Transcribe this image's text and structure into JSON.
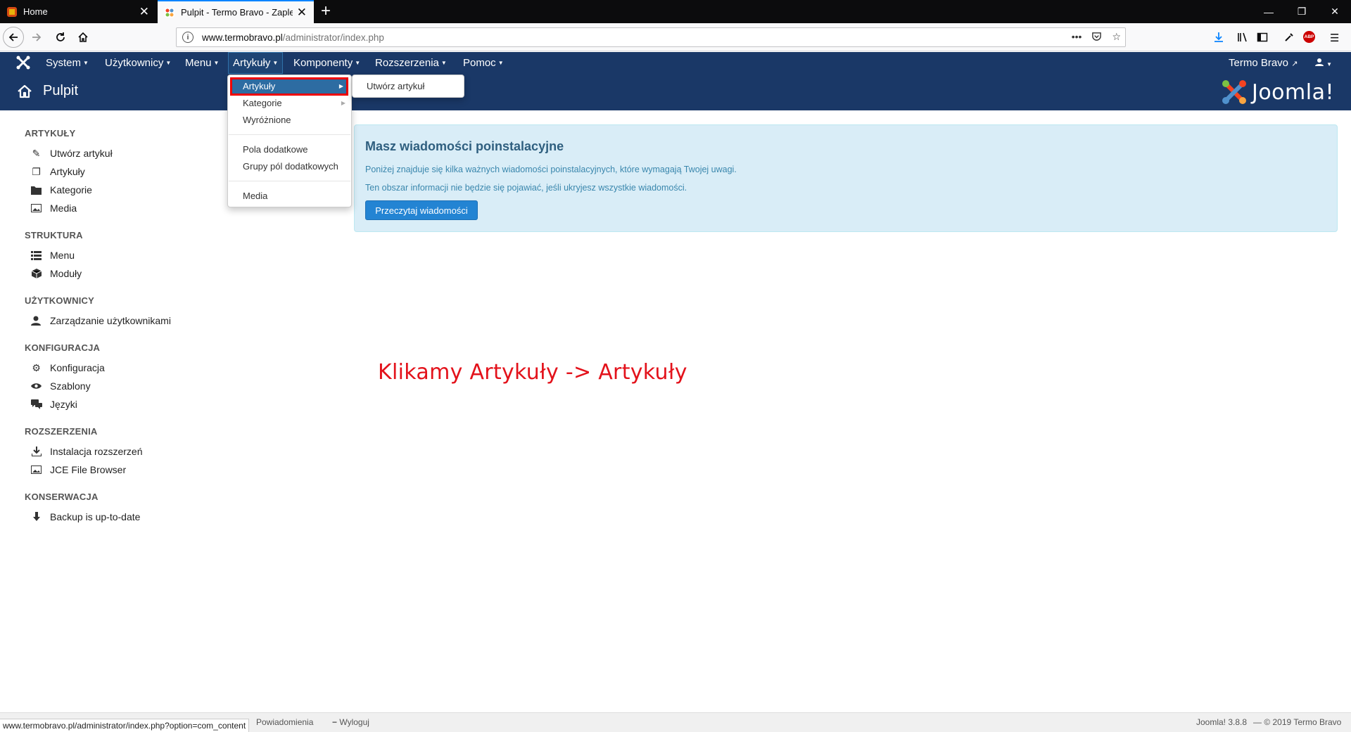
{
  "browser": {
    "tabs": [
      {
        "title": "Home",
        "close": "✕"
      },
      {
        "title": "Pulpit - Termo Bravo - Zaplecze",
        "close": "✕"
      }
    ],
    "new_tab": "+",
    "url_host": "www.termobravo.pl",
    "url_path": "/administrator/index.php",
    "url_actions": "•••",
    "status_url": "www.termobravo.pl/administrator/index.php?option=com_content",
    "abp_label": "ABP"
  },
  "topmenu": {
    "items": [
      "System",
      "Użytkownicy",
      "Menu",
      "Artykuły",
      "Komponenty",
      "Rozszerzenia",
      "Pomoc"
    ],
    "user_site": "Termo Bravo"
  },
  "header": {
    "title": "Pulpit",
    "brand": "Joomla!"
  },
  "sidebar": {
    "sections": [
      {
        "title": "ARTYKUŁY",
        "items": [
          {
            "label": "Utwórz artykuł",
            "icon": "pencil-icon"
          },
          {
            "label": "Artykuły",
            "icon": "copy-icon"
          },
          {
            "label": "Kategorie",
            "icon": "folder-icon"
          },
          {
            "label": "Media",
            "icon": "image-icon"
          }
        ]
      },
      {
        "title": "STRUKTURA",
        "items": [
          {
            "label": "Menu",
            "icon": "list-icon"
          },
          {
            "label": "Moduły",
            "icon": "cube-icon"
          }
        ]
      },
      {
        "title": "UŻYTKOWNICY",
        "items": [
          {
            "label": "Zarządzanie użytkownikami",
            "icon": "users-icon"
          }
        ]
      },
      {
        "title": "KONFIGURACJA",
        "items": [
          {
            "label": "Konfiguracja",
            "icon": "cog-icon"
          },
          {
            "label": "Szablony",
            "icon": "eye-icon"
          },
          {
            "label": "Języki",
            "icon": "comments-icon"
          }
        ]
      },
      {
        "title": "ROZSZERZENIA",
        "items": [
          {
            "label": "Instalacja rozszerzeń",
            "icon": "download-icon"
          },
          {
            "label": "JCE File Browser",
            "icon": "image-icon"
          }
        ]
      },
      {
        "title": "KONSERWACJA",
        "items": [
          {
            "label": "Backup is up-to-date",
            "icon": "backup-icon"
          }
        ]
      }
    ]
  },
  "dropdown": {
    "items": [
      "Artykuły",
      "Kategorie",
      "Wyróżnione",
      "Pola dodatkowe",
      "Grupy pól dodatkowych",
      "Media"
    ],
    "submenu": [
      "Utwórz artykuł"
    ]
  },
  "message": {
    "title": "Masz wiadomości poinstalacyjne",
    "line1": "Poniżej znajduje się kilka ważnych wiadomości poinstalacyjnych, które wymagają Twojej uwagi.",
    "line2": "Ten obszar informacji nie będzie się pojawiać, jeśli ukryjesz wszystkie wiadomości.",
    "button": "Przeczytaj wiadomości"
  },
  "annotation": "Klikamy Artykuły -> Artykuły",
  "footer": {
    "notifications": "Powiadomienia",
    "logout": "Wyloguj",
    "version": "Joomla! 3.8.8",
    "copyright": "— © 2019 Termo Bravo"
  },
  "colors": {
    "joomla_bar": "#1a3867",
    "highlight_border": "#e00000",
    "annotation": "#e3121b",
    "message_bg": "#d9edf7",
    "button": "#2384d3"
  }
}
